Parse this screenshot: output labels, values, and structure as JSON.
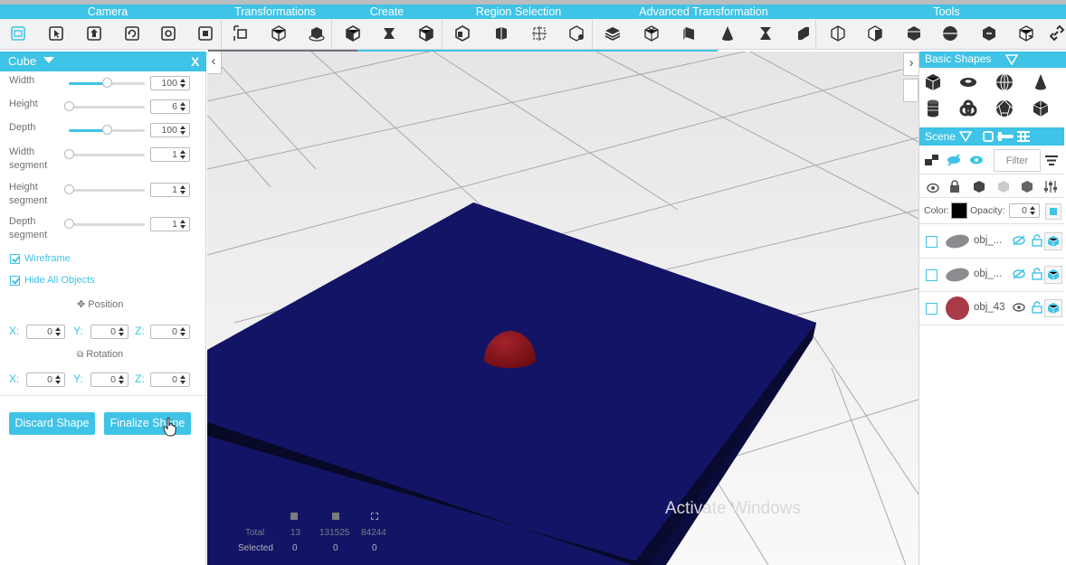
{
  "menubar": {
    "categories": [
      "Camera",
      "Transformations",
      "Create",
      "Region Selection",
      "Advanced Transformation",
      "Tools"
    ]
  },
  "left_panel": {
    "title": "Cube",
    "close_label": "X",
    "params": [
      {
        "label": "Width",
        "value": "100",
        "slider": 0.5
      },
      {
        "label": "Height",
        "value": "6",
        "slider": 0.0
      },
      {
        "label": "Depth",
        "value": "100",
        "slider": 0.5
      },
      {
        "label": "Width\nsegment",
        "value": "1",
        "slider": 0.0
      },
      {
        "label": "Height\nsegment",
        "value": "1",
        "slider": 0.0
      },
      {
        "label": "Depth\nsegment",
        "value": "1",
        "slider": 0.0
      }
    ],
    "wireframe_label": "Wireframe",
    "hide_all_label": "Hide All Objects",
    "position_label": "Position",
    "rotation_label": "Rotation",
    "position": {
      "x": "0",
      "y": "0",
      "z": "0"
    },
    "rotation": {
      "x": "0",
      "y": "0",
      "z": "0"
    },
    "axis_x": "X:",
    "axis_y": "Y:",
    "axis_z": "Z:",
    "discard_label": "Discard Shape",
    "finalize_label": "Finalize Shape"
  },
  "viewport": {
    "stats": {
      "total_label": "Total",
      "selected_label": "Selected",
      "total_values": [
        "13",
        "131525",
        "84244"
      ],
      "selected_values": [
        "0",
        "0",
        "0"
      ]
    },
    "watermark": "Activate Windows",
    "colors": {
      "plane": "#10115c",
      "sphere": "#8e1419",
      "floor": "#ededed"
    }
  },
  "right_panel": {
    "basic_shapes_title": "Basic Shapes",
    "scene_title": "Scene",
    "filter_placeholder": "Filter",
    "color_label": "Color:",
    "opacity_label": "Opacity:",
    "opacity_value": "0",
    "color_swatch": "#000000",
    "objects": [
      {
        "name": "obj_...",
        "shape": "disc",
        "color": "#8a8c8f"
      },
      {
        "name": "obj_...",
        "shape": "disc",
        "color": "#8a8c8f"
      },
      {
        "name": "obj_43",
        "shape": "sphere",
        "color": "#a83b47"
      }
    ]
  },
  "accent_color": "#3fc3e6"
}
